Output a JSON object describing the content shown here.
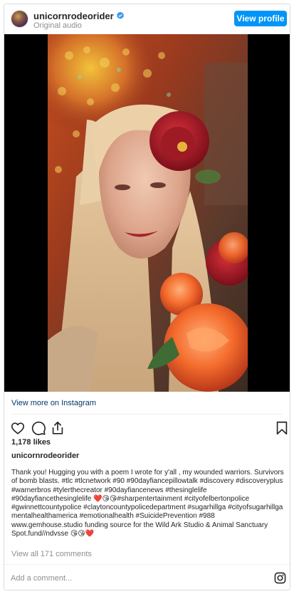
{
  "header": {
    "username": "unicornrodeorider",
    "subtitle": "Original audio",
    "profile_button": "View profile"
  },
  "media": {
    "view_more_link": "View more on Instagram"
  },
  "post": {
    "likes": "1,178 likes",
    "owner": "unicornrodeorider",
    "caption": "Thank you! Hugging you with a poem I wrote for y'all , my wounded warriors. Survivors of bomb blasts. #tlc #tlcnetwork #90 #90dayfiancepillowtalk #discovery #discoveryplus #warnerbros #tylerthecreator #90dayfiancenews #thesinglelife #90dayfiancethesinglelife ❤️😘😘#sharpentertainment #cityofelbertonpolice #gwinnettcountypolice #claytoncountypolicedepartment #sugarhillga #cityofsugarhillga mentalhealthamerica #emotionalhealth #SuicidePrevention #988 www.gemhouse.studio funding source for the Wild Ark Studio & Animal Sanctuary Spot.fund//ndvsse 😘😘❤️",
    "view_comments": "View all 171 comments"
  },
  "comment_box": {
    "placeholder": "Add a comment..."
  },
  "icons": {
    "like": "heart-icon",
    "comment": "comment-icon",
    "share": "share-icon",
    "save": "bookmark-icon",
    "instagram": "instagram-icon",
    "verified": "verified-badge-icon"
  },
  "colors": {
    "accent": "#0095f6",
    "link": "#00376b",
    "muted": "#8e8e8e"
  }
}
